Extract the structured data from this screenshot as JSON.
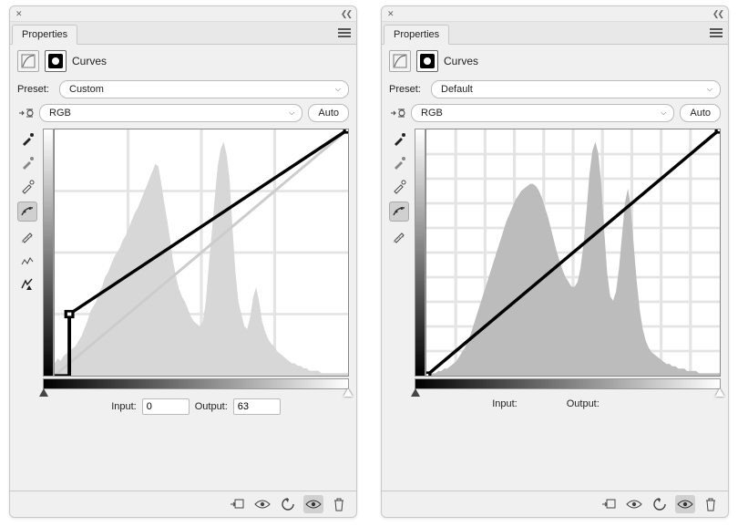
{
  "left": {
    "tab_label": "Properties",
    "adjustment_title": "Curves",
    "preset_label": "Preset:",
    "preset_value": "Custom",
    "channel_value": "RGB",
    "auto_label": "Auto",
    "input_label": "Input:",
    "output_label": "Output:",
    "input_value": "0",
    "output_value": "63",
    "histogram": [
      5,
      7,
      6,
      8,
      9,
      10,
      11,
      12,
      14,
      16,
      19,
      22,
      26,
      28,
      30,
      34,
      36,
      40,
      42,
      45,
      48,
      50,
      52,
      55,
      57,
      60,
      63,
      66,
      68,
      71,
      74,
      77,
      80,
      83,
      86,
      85,
      78,
      70,
      63,
      55,
      46,
      40,
      35,
      32,
      30,
      27,
      24,
      22,
      21,
      20,
      22,
      30,
      45,
      58,
      72,
      85,
      92,
      95,
      90,
      80,
      60,
      42,
      30,
      25,
      20,
      19,
      24,
      32,
      36,
      30,
      22,
      18,
      15,
      13,
      12,
      10,
      9,
      8,
      7,
      6,
      5,
      5,
      4,
      4,
      3,
      3,
      2,
      2,
      2,
      2,
      1,
      1,
      1,
      1,
      1,
      1,
      1,
      1,
      1,
      1
    ],
    "curve": {
      "p1_x": 0.05,
      "p1_y": 0.25,
      "p2_x": 1.0,
      "p2_y": 1.0
    }
  },
  "right": {
    "tab_label": "Properties",
    "adjustment_title": "Curves",
    "preset_label": "Preset:",
    "preset_value": "Default",
    "channel_value": "RGB",
    "auto_label": "Auto",
    "input_label": "Input:",
    "output_label": "Output:",
    "histogram": [
      1,
      1,
      1,
      1,
      2,
      2,
      3,
      3,
      4,
      5,
      6,
      8,
      10,
      12,
      15,
      18,
      22,
      26,
      30,
      34,
      38,
      42,
      46,
      50,
      54,
      58,
      62,
      66,
      69,
      72,
      75,
      77,
      79,
      80,
      81,
      82,
      82,
      81,
      79,
      76,
      72,
      68,
      63,
      58,
      53,
      49,
      45,
      42,
      40,
      38,
      38,
      40,
      46,
      56,
      70,
      86,
      96,
      100,
      95,
      82,
      62,
      44,
      34,
      32,
      36,
      46,
      60,
      74,
      80,
      72,
      55,
      40,
      28,
      20,
      15,
      12,
      10,
      9,
      8,
      7,
      6,
      5,
      5,
      4,
      4,
      3,
      3,
      3,
      2,
      2,
      2,
      2,
      1,
      1,
      1,
      1,
      1,
      1,
      1,
      1
    ],
    "curve": {
      "p1_x": 0.0,
      "p1_y": 0.0,
      "p2_x": 1.0,
      "p2_y": 1.0
    }
  },
  "icons": {
    "hand_target": "hand-adjust",
    "eyedropper": "eyedropper",
    "curves": "curves",
    "pencil": "pencil",
    "smooth": "smooth",
    "clip": "clip-layer",
    "eye": "visibility",
    "reset": "reset",
    "prev": "previous-state",
    "trash": "delete"
  }
}
